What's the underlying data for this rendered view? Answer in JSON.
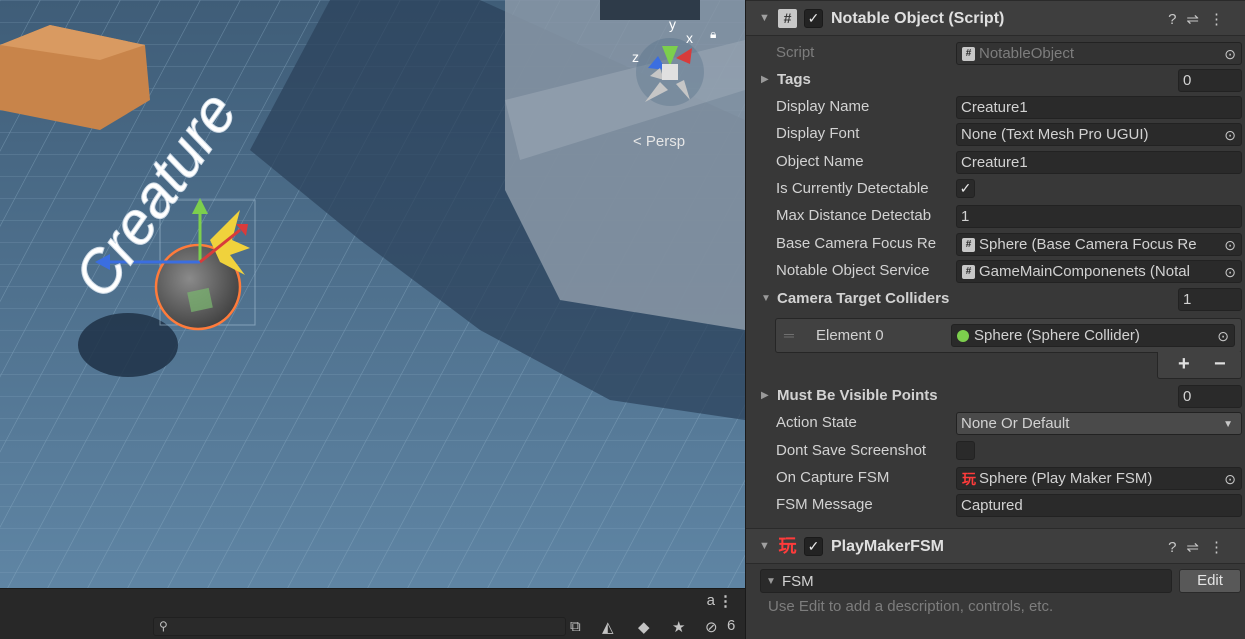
{
  "scene": {
    "perspective_label": "< Persp",
    "gizmo_axes": {
      "x": "x",
      "y": "y",
      "z": "z"
    },
    "object_label": "Creature",
    "search_placeholder": "",
    "hidden_count": "6"
  },
  "component1": {
    "title": "Notable Object (Script)",
    "enabled": "✓",
    "fields": {
      "script_label": "Script",
      "script_value": "NotableObject",
      "tags_label": "Tags",
      "tags_count": "0",
      "display_name_label": "Display Name",
      "display_name_value": "Creature1",
      "display_font_label": "Display Font",
      "display_font_value": "None (Text Mesh Pro UGUI)",
      "object_name_label": "Object Name",
      "object_name_value": "Creature1",
      "is_detectable_label": "Is Currently Detectable",
      "is_detectable_value": "✓",
      "max_distance_label": "Max Distance Detectab",
      "max_distance_value": "1",
      "base_camera_label": "Base Camera Focus Re",
      "base_camera_value": "Sphere (Base Camera Focus Re",
      "notable_service_label": "Notable Object Service",
      "notable_service_value": "GameMainComponenets (Notal",
      "camera_colliders_label": "Camera Target Colliders",
      "camera_colliders_count": "1",
      "element0_label": "Element 0",
      "element0_value": "Sphere (Sphere Collider)",
      "plus": "+",
      "minus": "−",
      "visible_points_label": "Must Be Visible Points",
      "visible_points_count": "0",
      "action_state_label": "Action State",
      "action_state_value": "None Or Default",
      "dont_save_label": "Dont Save Screenshot",
      "on_capture_label": "On Capture FSM",
      "on_capture_value": "Sphere (Play Maker FSM)",
      "fsm_message_label": "FSM Message",
      "fsm_message_value": "Captured"
    }
  },
  "component2": {
    "title": "PlayMakerFSM",
    "enabled": "✓",
    "fsm_name": "FSM",
    "edit_label": "Edit",
    "hint": "Use Edit to add a description, controls, etc."
  },
  "colors": {
    "scene_sky": "#4f6c88",
    "gizmo_x": "#d83b3b",
    "gizmo_y": "#7ccf4d",
    "gizmo_z": "#3b6ee0",
    "fsm_icon": "#ff3b3b"
  }
}
